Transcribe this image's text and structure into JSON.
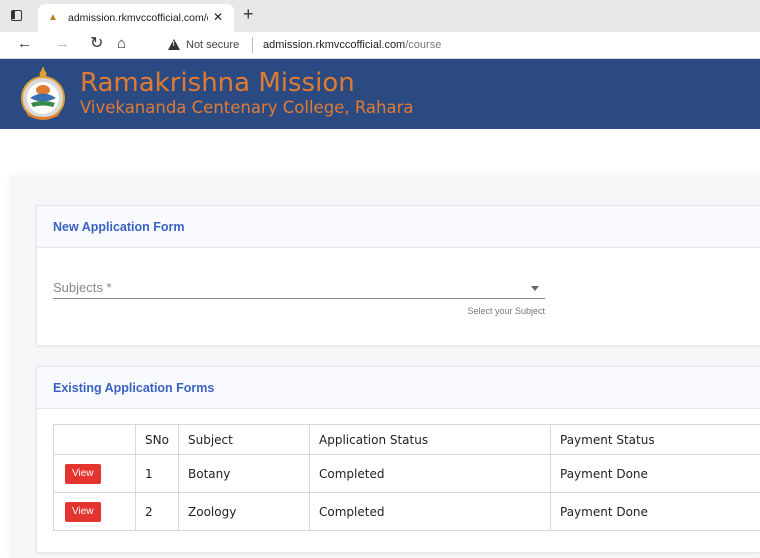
{
  "browser": {
    "tab_title": "admission.rkmvccofficial.com/co",
    "not_secure_label": "Not secure",
    "url_host": "admission.rkmvccofficial.com",
    "url_path": "/course"
  },
  "site": {
    "title": "Ramakrishna Mission",
    "subtitle": "Vivekananda Centenary College, Rahara",
    "brand_color": "#2c4a82",
    "title_color": "#e07b32"
  },
  "new_form": {
    "title": "New Application Form",
    "subjects_label": "Subjects *",
    "subjects_help": "Select your Subject"
  },
  "existing_forms": {
    "title": "Existing Application Forms",
    "columns": [
      "",
      "SNo",
      "Subject",
      "Application Status",
      "Payment Status"
    ],
    "view_label": "View",
    "rows": [
      {
        "sno": "1",
        "subject": "Botany",
        "app_status": "Completed",
        "payment_status": "Payment Done"
      },
      {
        "sno": "2",
        "subject": "Zoology",
        "app_status": "Completed",
        "payment_status": "Payment Done"
      }
    ]
  },
  "accent_color": "#3b62c2",
  "view_button_color": "#e3342f"
}
